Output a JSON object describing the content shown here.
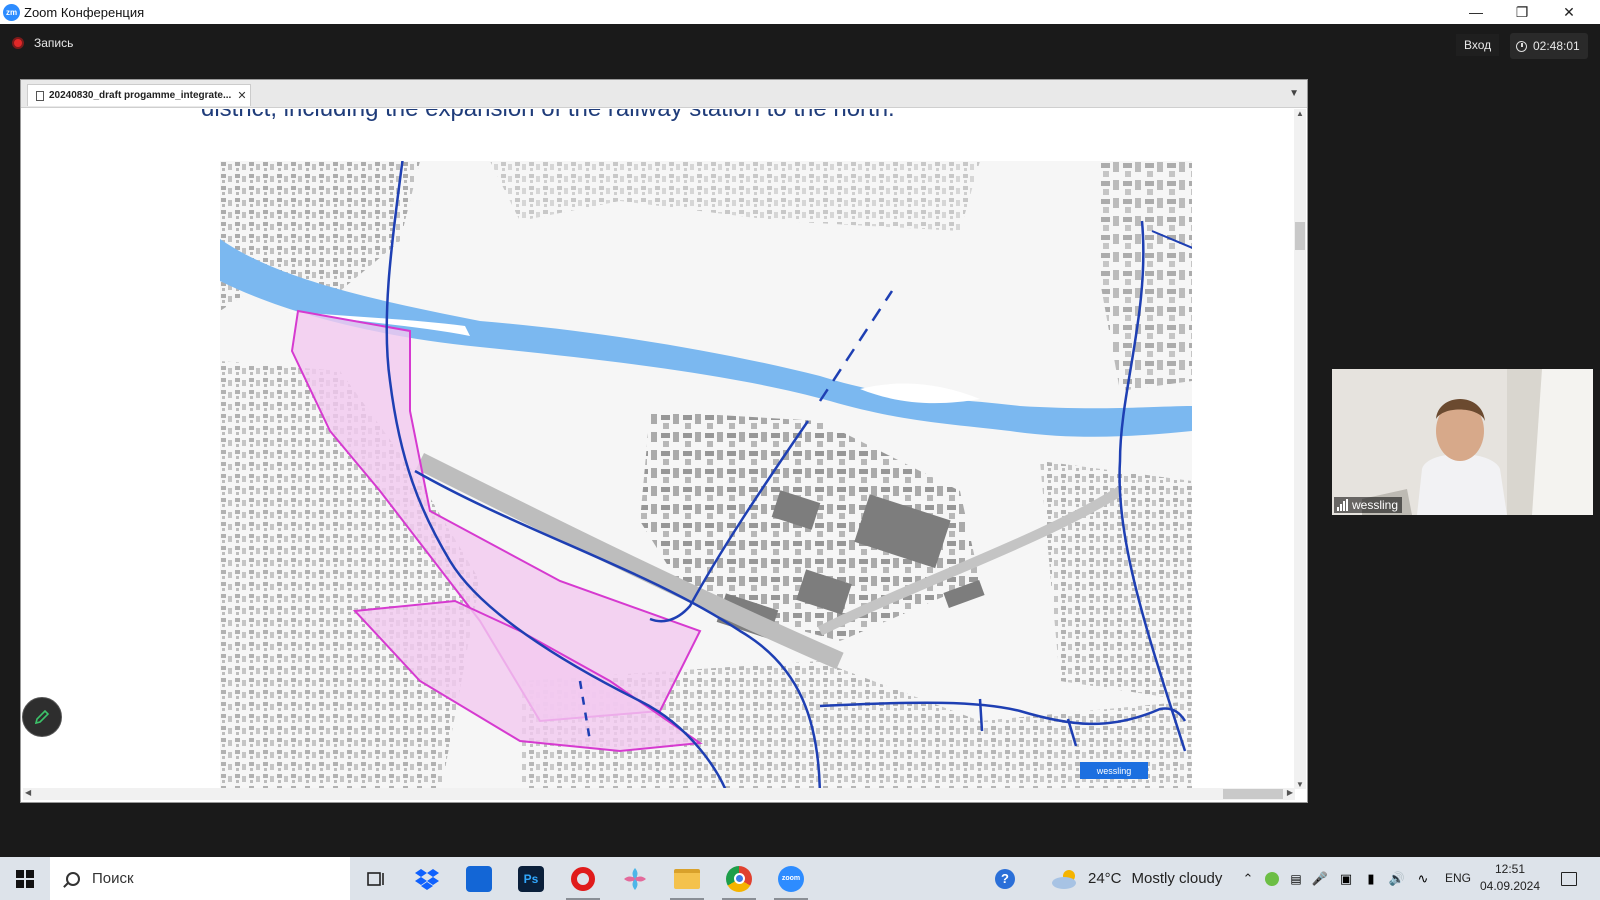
{
  "window": {
    "title": "Zoom Конференция"
  },
  "zoom_bar": {
    "recording_label": "Запись",
    "login_label": "Вход",
    "timer": "02:48:01"
  },
  "share": {
    "tab_title": "20240830_draft progamme_integrate...",
    "slide_text": "district, including the expansion of the railway station to the north.",
    "map_label": "wessling"
  },
  "participant": {
    "name": "wessling"
  },
  "taskbar": {
    "search_placeholder": "Поиск",
    "apps": [
      "task-view",
      "dropbox",
      "microsoft-store",
      "photoshop",
      "opera",
      "pinwheel-app",
      "file-explorer",
      "chrome",
      "zoom"
    ],
    "weather": {
      "temp": "24°C",
      "desc": "Mostly cloudy"
    },
    "language": "ENG",
    "time": "12:51",
    "date": "04.09.2024"
  },
  "colors": {
    "zoom_blue": "#2d8cff",
    "river": "#7bb8f0",
    "route_line": "#1e3fb3",
    "zone_fill": "#f3c9f0",
    "zone_stroke": "#d63ad0",
    "record_red": "#e02828"
  }
}
